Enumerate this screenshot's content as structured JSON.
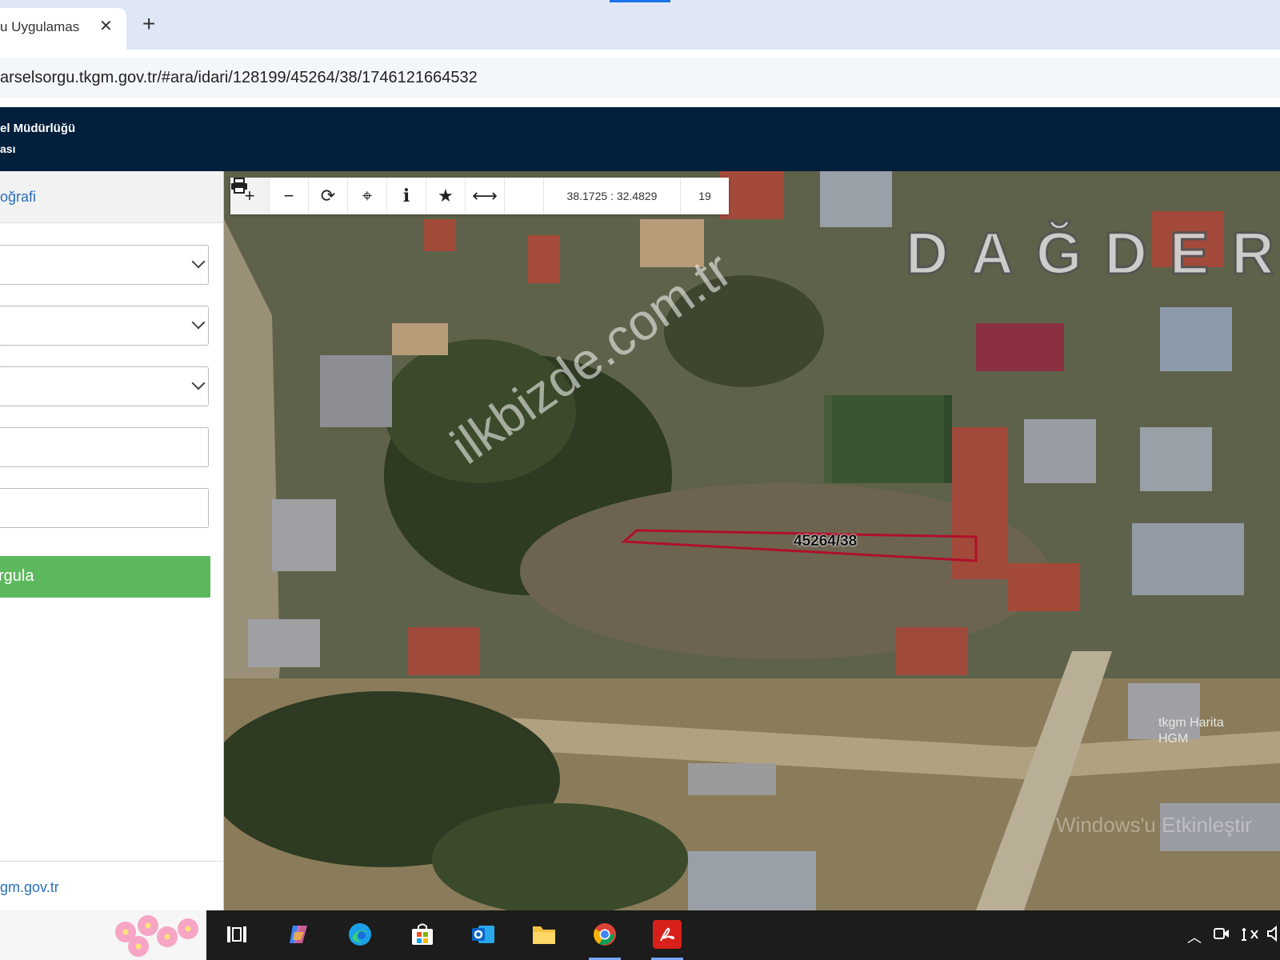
{
  "browser": {
    "tab_title": "u Uygulamas",
    "tab_close": "✕",
    "new_tab": "+",
    "url": "arselsorgu.tkgm.gov.tr/#ara/idari/128199/45264/38/1746121664532"
  },
  "site_header": {
    "line1": "el Müdürlüğü",
    "line2": "ası"
  },
  "sidebar": {
    "tab_label": "oğrafi",
    "fields": [
      {
        "type": "select",
        "value": ""
      },
      {
        "type": "select",
        "value": ""
      },
      {
        "type": "select",
        "value": ""
      },
      {
        "type": "text",
        "value": ""
      },
      {
        "type": "text",
        "value": ""
      }
    ],
    "query_button": "rgula",
    "footer_link": "gm.gov.tr"
  },
  "map": {
    "toolbar": {
      "zoom_in": "+",
      "zoom_out": "−",
      "refresh": "⟳",
      "locate": "⌖",
      "info": "i",
      "favorite": "★",
      "measure": "⟷",
      "print": "🖶",
      "coordinates": "38.1725 : 32.4829",
      "zoom_level": "19"
    },
    "neighborhood_label": "DAĞDER",
    "watermark": "ilkbizde.com.tr",
    "parcel_label": "45264/38",
    "tkgm_watermark_line1": "tkgm Harita",
    "tkgm_watermark_line2": "HGM",
    "windows_watermark": "Windows'u Etkinleştir",
    "colors": {
      "parcel_outline": "#b0102a",
      "header_bg": "#021f3c",
      "query_btn": "#5cb85c"
    }
  },
  "taskbar": {
    "icons": [
      "task-view-icon",
      "copilot-icon",
      "edge-icon",
      "store-icon",
      "outlook-icon",
      "file-explorer-icon",
      "chrome-icon",
      "acrobat-icon"
    ],
    "tray": {
      "chevron": "︿"
    }
  }
}
